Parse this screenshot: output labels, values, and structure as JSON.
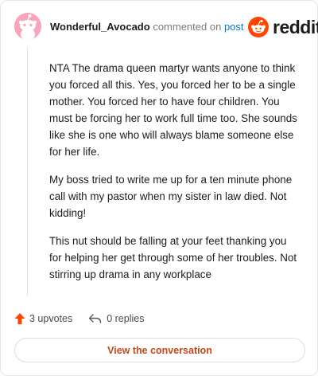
{
  "comment": {
    "username": "Wonderful_Avocado",
    "commented_text": "commented on",
    "post_link": "post",
    "paragraphs": [
      "NTA The drama queen martyr wants anyone to think you forced all this. Yes, you forced her to be a single mother. You forced her to have four children. You must be forcing her to work full time too. She sounds like she is one who will always blame someone else for her life.",
      "My boss tried to write me up for a ten minute phone call with my pastor when my sister in law died. Not kidding!",
      "This nut should be falling at your feet thanking you for helping her get through some of her troubles. Not stirring up drama in any workplace"
    ]
  },
  "brand": {
    "logo_text": "reddit",
    "accent_color": "#ff4500"
  },
  "actions": {
    "upvotes_label": "3 upvotes",
    "replies_label": "0 replies",
    "upvote_color": "#ff4500"
  },
  "footer": {
    "view_label": "View the conversation",
    "view_color": "#c5471b"
  },
  "icons": {
    "avatar": "snoo-avatar-icon",
    "logo": "reddit-snoo-icon",
    "upvote": "upvote-arrow-icon",
    "reply": "reply-arrow-icon"
  }
}
